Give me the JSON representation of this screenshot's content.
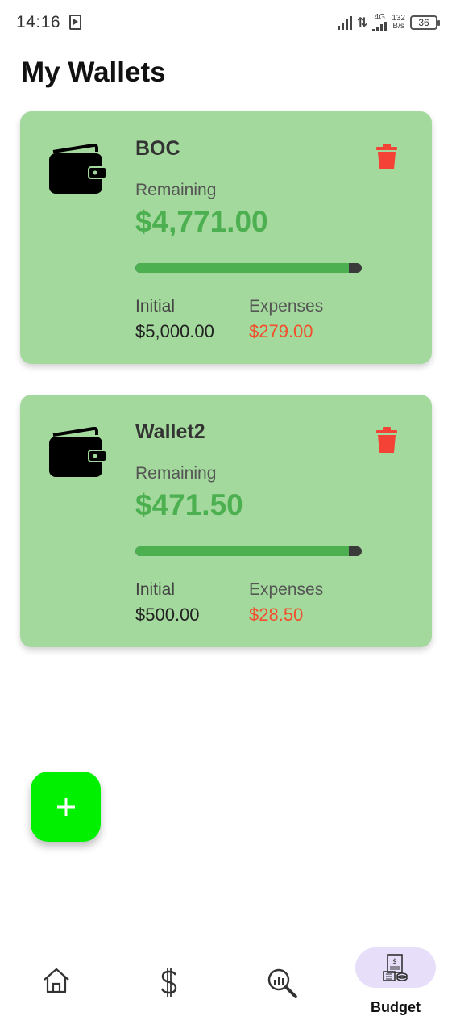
{
  "status_bar": {
    "time": "14:16",
    "network": "4G",
    "speed_top": "132",
    "speed_bottom": "B/s",
    "battery": "36"
  },
  "page": {
    "title": "My Wallets"
  },
  "wallets": [
    {
      "name": "BOC",
      "remaining_label": "Remaining",
      "remaining": "$4,771.00",
      "progress_fraction": 0.944,
      "initial_label": "Initial",
      "initial": "$5,000.00",
      "expenses_label": "Expenses",
      "expenses": "$279.00"
    },
    {
      "name": "Wallet2",
      "remaining_label": "Remaining",
      "remaining": "$471.50",
      "progress_fraction": 0.943,
      "initial_label": "Initial",
      "initial": "$500.00",
      "expenses_label": "Expenses",
      "expenses": "$28.50"
    }
  ],
  "fab": {
    "icon": "plus-icon"
  },
  "nav": {
    "items": [
      {
        "icon": "home-icon"
      },
      {
        "icon": "dollar-icon"
      },
      {
        "icon": "analytics-search-icon"
      },
      {
        "icon": "budget-icon",
        "label": "Budget",
        "active": true
      }
    ]
  },
  "colors": {
    "card_bg": "#a3d99c",
    "remaining": "#4caf50",
    "expenses": "#f24e2b",
    "trash": "#f44336",
    "fab": "#00f000",
    "nav_active": "#e7defa"
  }
}
